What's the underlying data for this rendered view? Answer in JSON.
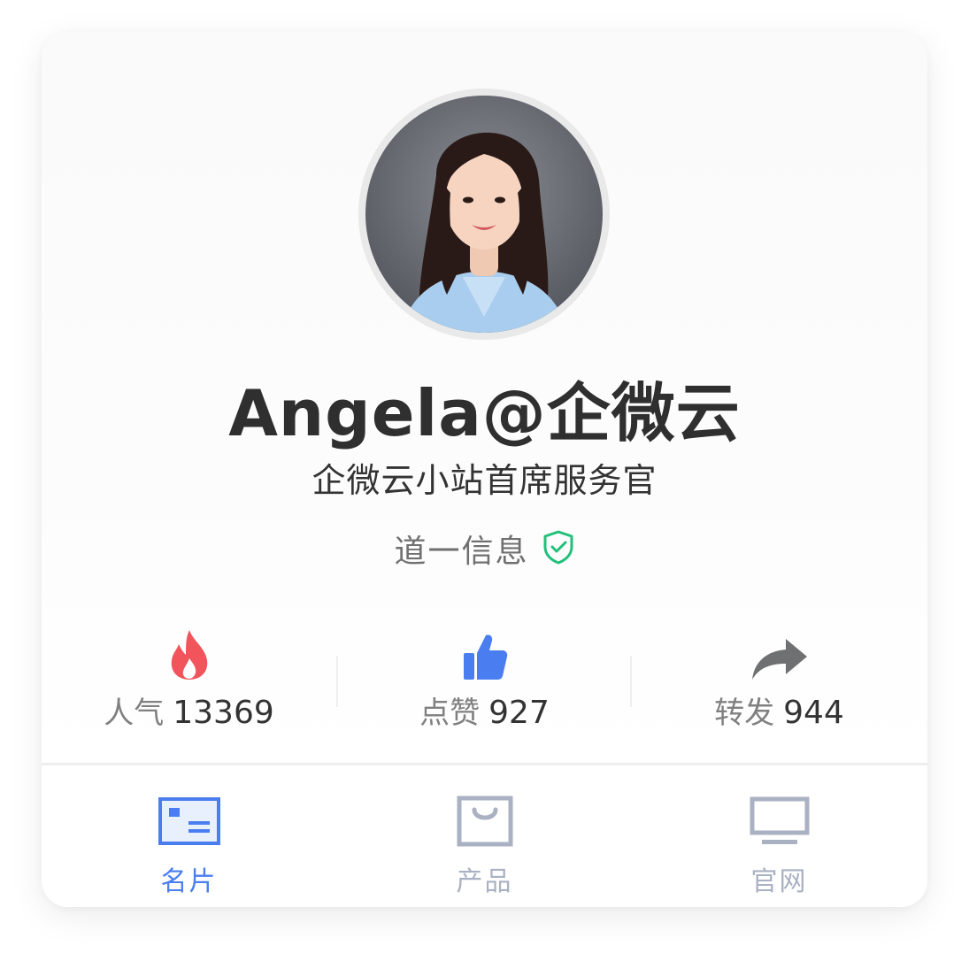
{
  "profile": {
    "name": "Angela@企微云",
    "title": "企微云小站首席服务官",
    "company": "道一信息"
  },
  "stats": [
    {
      "label": "人气",
      "value": "13369",
      "icon": "fire-icon",
      "color": "#f2545b"
    },
    {
      "label": "点赞",
      "value": "927",
      "icon": "thumbs-up-icon",
      "color": "#4a7ef0"
    },
    {
      "label": "转发",
      "value": "944",
      "icon": "share-arrow-icon",
      "color": "#6f7072"
    }
  ],
  "tabs": [
    {
      "label": "名片",
      "icon": "business-card-icon",
      "active": true
    },
    {
      "label": "产品",
      "icon": "shopping-bag-icon",
      "active": false
    },
    {
      "label": "官网",
      "icon": "monitor-icon",
      "active": false
    }
  ],
  "colors": {
    "accent": "#4a7ef0",
    "inactive": "#a9b1c3",
    "verified": "#22c07a"
  }
}
